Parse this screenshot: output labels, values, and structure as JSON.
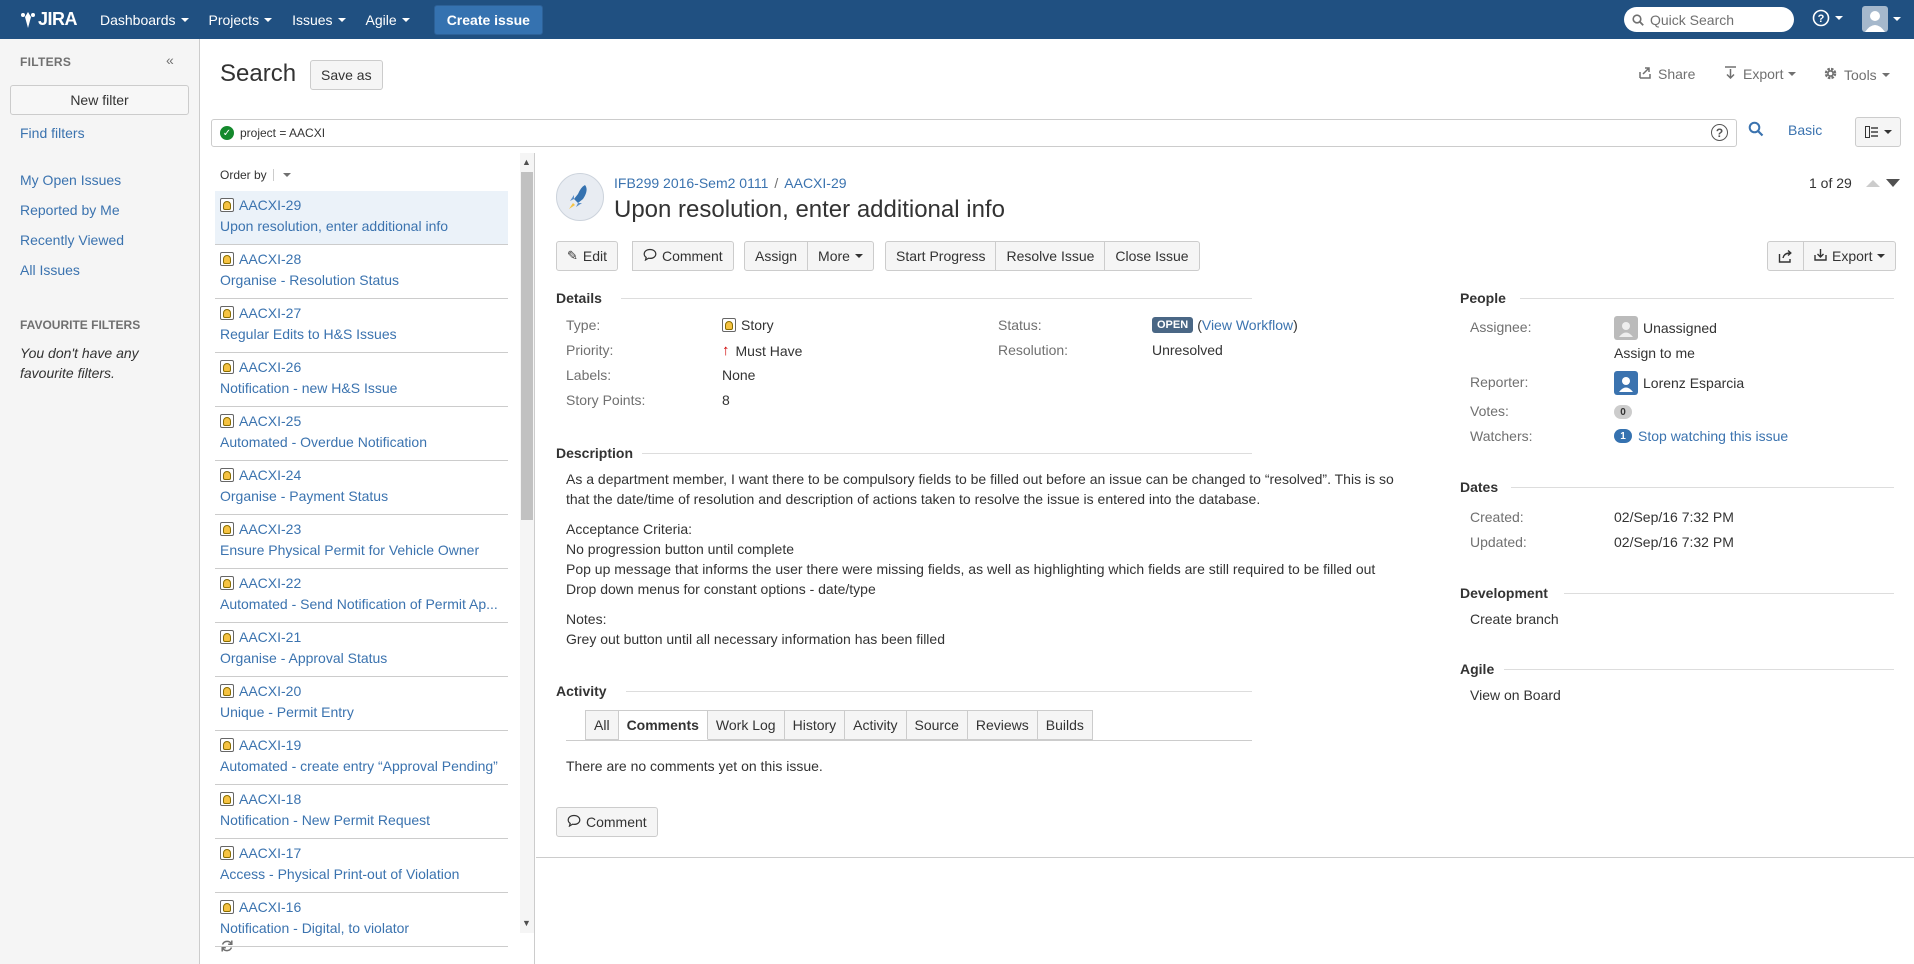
{
  "topnav": {
    "logo": "JIRA",
    "menus": [
      "Dashboards",
      "Projects",
      "Issues",
      "Agile"
    ],
    "create_label": "Create issue",
    "quick_search_placeholder": "Quick Search"
  },
  "sidebar": {
    "title": "FILTERS",
    "new_filter": "New filter",
    "find_filters": "Find filters",
    "links": [
      "My Open Issues",
      "Reported by Me",
      "Recently Viewed",
      "All Issues"
    ],
    "favourite_title": "FAVOURITE FILTERS",
    "favourite_empty": "You don't have any favourite filters."
  },
  "search": {
    "title": "Search",
    "save_as": "Save as",
    "share": "Share",
    "export": "Export",
    "tools": "Tools",
    "query": "project = AACXI",
    "basic": "Basic"
  },
  "list": {
    "order_by": "Order by",
    "issues": [
      {
        "key": "AACXI-29",
        "summary": "Upon resolution, enter additional info"
      },
      {
        "key": "AACXI-28",
        "summary": "Organise - Resolution Status"
      },
      {
        "key": "AACXI-27",
        "summary": "Regular Edits to H&S Issues"
      },
      {
        "key": "AACXI-26",
        "summary": "Notification - new H&S Issue"
      },
      {
        "key": "AACXI-25",
        "summary": "Automated - Overdue Notification"
      },
      {
        "key": "AACXI-24",
        "summary": "Organise - Payment Status"
      },
      {
        "key": "AACXI-23",
        "summary": "Ensure Physical Permit for Vehicle Owner"
      },
      {
        "key": "AACXI-22",
        "summary": "Automated - Send Notification of Permit Ap..."
      },
      {
        "key": "AACXI-21",
        "summary": "Organise - Approval Status"
      },
      {
        "key": "AACXI-20",
        "summary": "Unique - Permit Entry"
      },
      {
        "key": "AACXI-19",
        "summary": "Automated - create entry “Approval Pending”"
      },
      {
        "key": "AACXI-18",
        "summary": "Notification - New Permit Request"
      },
      {
        "key": "AACXI-17",
        "summary": "Access - Physical Print-out of Violation"
      },
      {
        "key": "AACXI-16",
        "summary": "Notification - Digital, to violator"
      }
    ]
  },
  "issue": {
    "project": "IFB299 2016-Sem2 0111",
    "key": "AACXI-29",
    "title": "Upon resolution, enter additional info",
    "pager": "1 of 29",
    "buttons": {
      "edit": "Edit",
      "comment": "Comment",
      "assign": "Assign",
      "more": "More",
      "start_progress": "Start Progress",
      "resolve": "Resolve Issue",
      "close": "Close Issue",
      "export": "Export"
    },
    "details_title": "Details",
    "fields": {
      "type_label": "Type:",
      "type": "Story",
      "priority_label": "Priority:",
      "priority": "Must Have",
      "labels_label": "Labels:",
      "labels": "None",
      "points_label": "Story Points:",
      "points": "8",
      "status_label": "Status:",
      "status": "OPEN",
      "view_workflow": "View Workflow",
      "resolution_label": "Resolution:",
      "resolution": "Unresolved"
    },
    "description_title": "Description",
    "description": {
      "p1": "As a department member, I want there to be compulsory fields to be filled out before an issue can be changed to “resolved”. This is so that the date/time of resolution and description of actions taken to resolve the issue is entered into the database.",
      "ac_title": "Acceptance Criteria:",
      "ac1": "No progression button until complete",
      "ac2": "Pop up message that informs the user there were missing fields, as well as highlighting which fields are still required to be filled out",
      "ac3": "Drop down menus for constant options - date/type",
      "notes_title": "Notes:",
      "notes1": "Grey out button until all necessary information has been filled"
    },
    "activity_title": "Activity",
    "tabs": [
      "All",
      "Comments",
      "Work Log",
      "History",
      "Activity",
      "Source",
      "Reviews",
      "Builds"
    ],
    "no_comments": "There are no comments yet on this issue.",
    "comment_button": "Comment"
  },
  "people": {
    "title": "People",
    "assignee_label": "Assignee:",
    "assignee": "Unassigned",
    "assign_to_me": "Assign to me",
    "reporter_label": "Reporter:",
    "reporter": "Lorenz Esparcia",
    "votes_label": "Votes:",
    "votes": "0",
    "watchers_label": "Watchers:",
    "watchers": "1",
    "stop_watching": "Stop watching this issue"
  },
  "dates": {
    "title": "Dates",
    "created_label": "Created:",
    "created": "02/Sep/16 7:32 PM",
    "updated_label": "Updated:",
    "updated": "02/Sep/16 7:32 PM"
  },
  "development": {
    "title": "Development",
    "create_branch": "Create branch"
  },
  "agile": {
    "title": "Agile",
    "view_on_board": "View on Board"
  }
}
